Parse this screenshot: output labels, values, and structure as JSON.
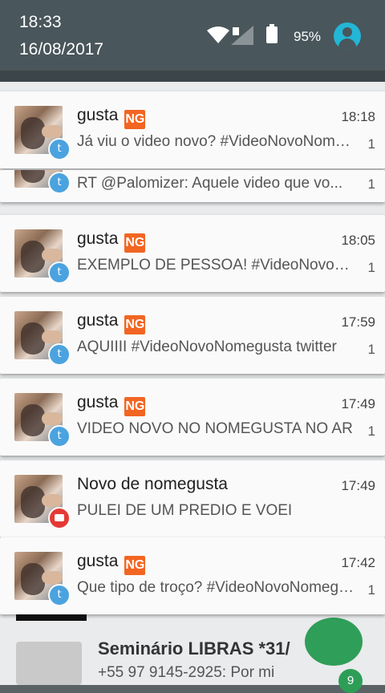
{
  "status_bar": {
    "time": "18:33",
    "date": "16/08/2017",
    "battery": "95%",
    "icons": [
      "wifi-icon",
      "signal-icon",
      "battery-icon",
      "user-account-icon"
    ]
  },
  "background": {
    "chat_name": "Seminário LIBRAS *31/",
    "chat_preview": "+55 97 9145-2925: Por mi",
    "unread_badge": "9"
  },
  "notifications": [
    {
      "app_icon": "twitter-icon",
      "title": "gusta",
      "ng_badge": "NG",
      "time": "18:18",
      "message": "Já viu o video novo? #VideoNovoNomegusta",
      "count": "1"
    },
    {
      "app_icon": "twitter-icon",
      "title": "",
      "ng_badge": "",
      "time": "",
      "message": "RT @Palomizer: Aquele video que vo...",
      "count": "1"
    },
    {
      "app_icon": "twitter-icon",
      "title": "gusta",
      "ng_badge": "NG",
      "time": "18:05",
      "message": "EXEMPLO DE PESSOA! #VideoNovoNomegusta",
      "count": "1"
    },
    {
      "app_icon": "twitter-icon",
      "title": "gusta",
      "ng_badge": "NG",
      "time": "17:59",
      "message": "AQUIIII #VideoNovoNomegusta twitter",
      "count": "1"
    },
    {
      "app_icon": "twitter-icon",
      "title": "gusta",
      "ng_badge": "NG",
      "time": "17:49",
      "message": "VIDEO NOVO NO NOMEGUSTA NO AR",
      "count": "1"
    },
    {
      "app_icon": "youtube-icon",
      "title": "Novo de nomegusta",
      "ng_badge": "",
      "time": "17:49",
      "message": "PULEI DE UM PREDIO E VOEI",
      "count": ""
    },
    {
      "app_icon": "twitter-icon",
      "title": "gusta",
      "ng_badge": "NG",
      "time": "17:42",
      "message": "Que tipo de troço? #VideoNovoNomegusta",
      "count": "1"
    }
  ]
}
